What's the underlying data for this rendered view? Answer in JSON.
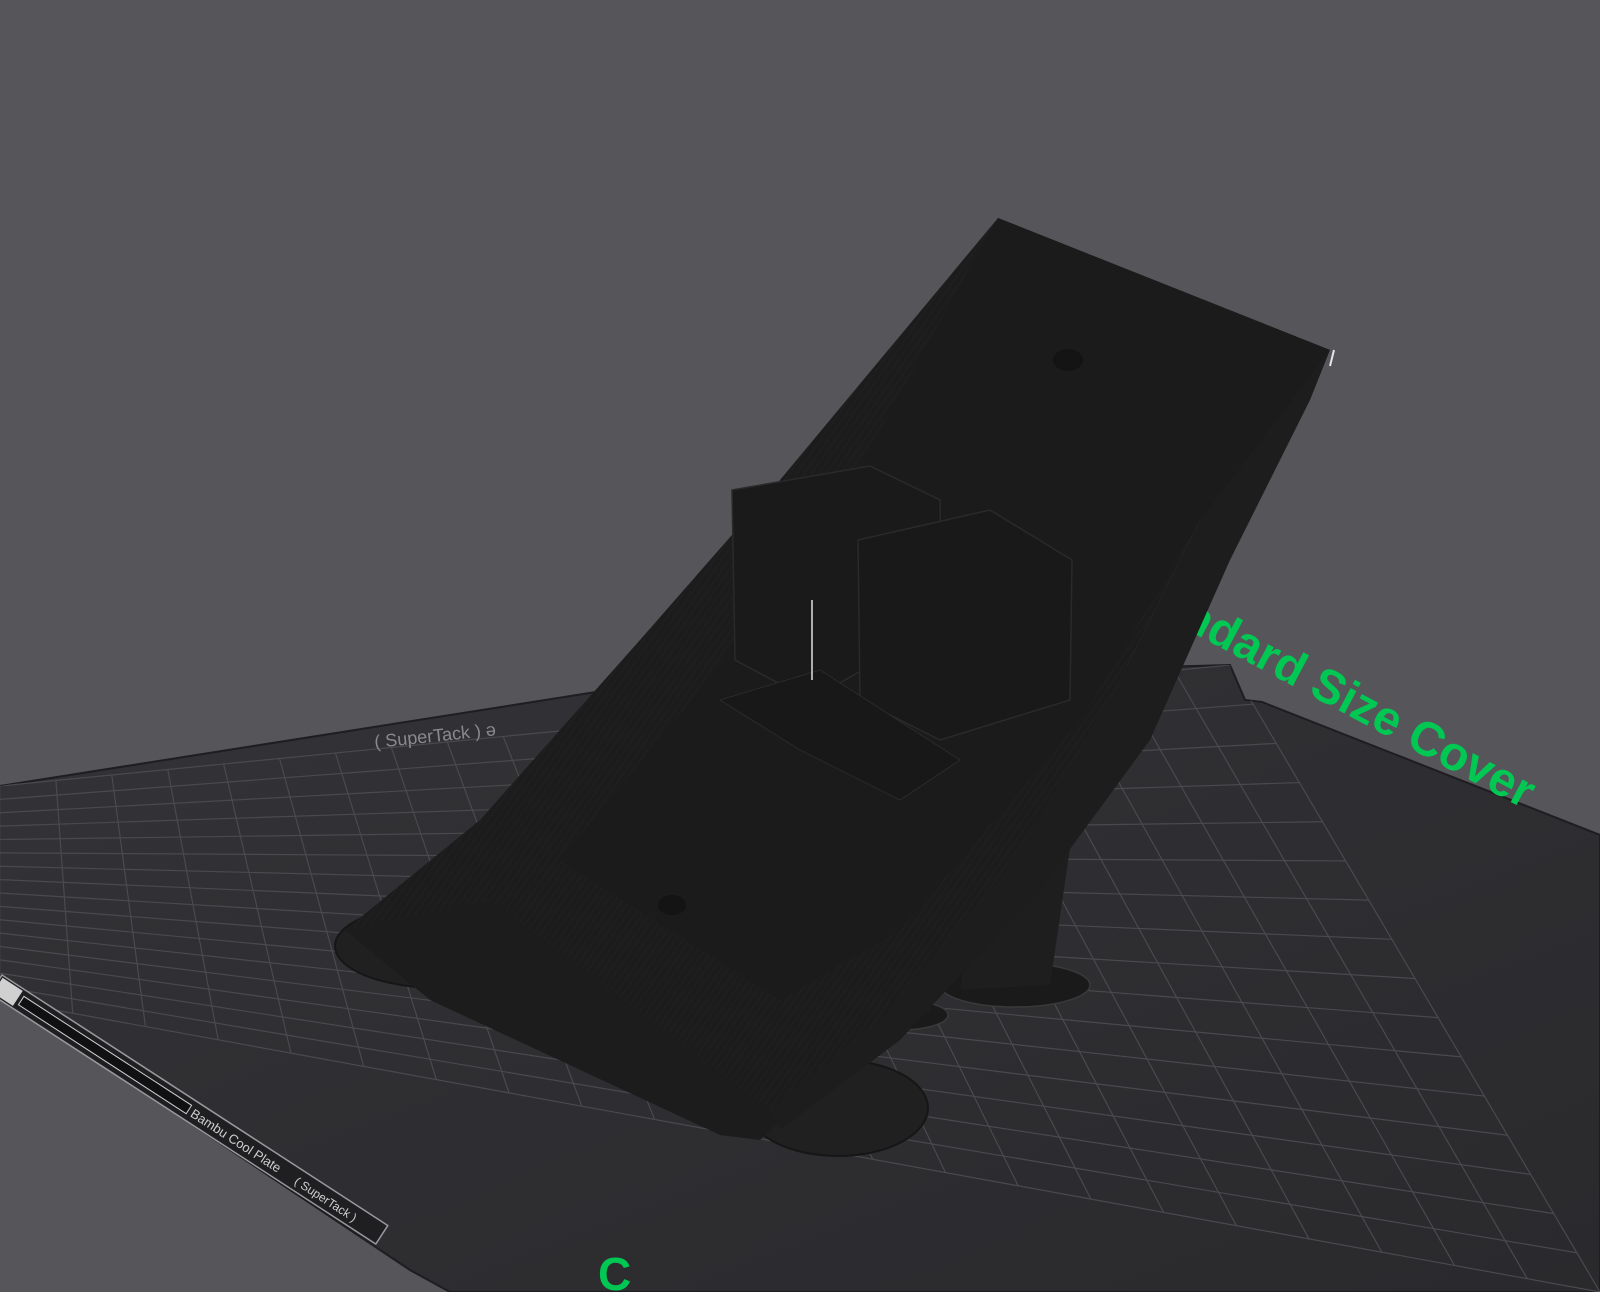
{
  "viewport": {
    "background": "#55555a",
    "plate_color": "#2d2d30",
    "grid_color": "#4a4a4e",
    "model_color": "#1b1b1b",
    "accent_color": "#00c853"
  },
  "plate": {
    "name_label": "Bambu Cool Plate",
    "type_label": "( SuperTack )",
    "mirrored_label": "( SuperTack ) ə",
    "logo_icon": "plate-logo-icon"
  },
  "cover_text": {
    "main": "ndard Size Cover",
    "bottom_fragment": "C"
  },
  "model": {
    "name": "angled-holder-model"
  }
}
